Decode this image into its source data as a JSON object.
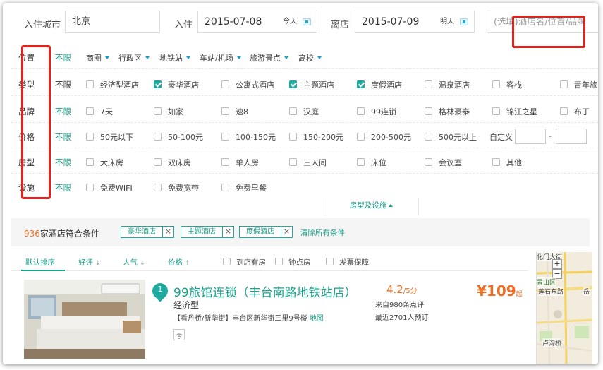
{
  "search": {
    "city_label": "入住城市",
    "city_value": "北京",
    "checkin_label": "入住",
    "checkin_date": "2015-07-08",
    "checkin_rel": "今天",
    "checkout_label": "离店",
    "checkout_date": "2015-07-09",
    "checkout_rel": "明天",
    "keyword_placeholder": "(选填)酒店名/位置/品牌"
  },
  "filters": {
    "location": {
      "name": "位置",
      "all": "不限",
      "dropdowns": [
        "商圈",
        "行政区",
        "地铁站",
        "车站/机场",
        "旅游景点",
        "高校"
      ]
    },
    "type": {
      "name": "类型",
      "all": "不限",
      "options": [
        {
          "label": "经济型酒店",
          "checked": false
        },
        {
          "label": "豪华酒店",
          "checked": true
        },
        {
          "label": "公寓式酒店",
          "checked": false
        },
        {
          "label": "主题酒店",
          "checked": true
        },
        {
          "label": "度假酒店",
          "checked": true
        },
        {
          "label": "温泉酒店",
          "checked": false
        },
        {
          "label": "客栈",
          "checked": false
        },
        {
          "label": "青年旅",
          "checked": false
        }
      ]
    },
    "brand": {
      "name": "品牌",
      "all": "不限",
      "options": [
        "7天",
        "如家",
        "速8",
        "汉庭",
        "99连锁",
        "格林豪泰",
        "锦江之星",
        "布丁"
      ]
    },
    "price": {
      "name": "价格",
      "all": "不限",
      "options": [
        "50元以下",
        "50-100元",
        "100-150元",
        "150-200元",
        "200-500元",
        "500元以上"
      ],
      "custom_label": "自定义",
      "separator": "-"
    },
    "room": {
      "name": "房型",
      "all": "不限",
      "options": [
        "大床房",
        "双床房",
        "单人房",
        "三人间",
        "床位",
        "会议室",
        "其他"
      ]
    },
    "facility": {
      "name": "设施",
      "all": "不限",
      "options": [
        "免费WIFI",
        "免费宽带",
        "免费早餐"
      ]
    },
    "expand_label": "房型及设施"
  },
  "summary": {
    "count": "936",
    "count_suffix": "家酒店符合条件",
    "tags": [
      "豪华酒店",
      "主题酒店",
      "度假酒店"
    ],
    "clear_all": "清除所有条件"
  },
  "sort": {
    "default": "默认排序",
    "rating": "好评",
    "popularity": "人气",
    "price": "价格",
    "checks": [
      "到店有房",
      "钟点房",
      "发票保障"
    ]
  },
  "hotel": {
    "index": "1",
    "name": "99旅馆连锁（丰台南路地铁站店）",
    "type": "经济型",
    "address": "【看丹桥/新华街】丰台区新华街三里9号楼",
    "map_link": "地图",
    "score": "4.2",
    "score_max": "/5分",
    "reviews": "来自980条点评",
    "booked": "最近2701人预订",
    "price": "¥109",
    "price_suffix": "起"
  },
  "map": {
    "labels": [
      "景山区",
      "莲石东路",
      "岳",
      "卢沟桥",
      "化门大街"
    ]
  },
  "colors": {
    "accent": "#1ba08a",
    "orange": "#f26c21",
    "annotation": "#e0231d"
  }
}
